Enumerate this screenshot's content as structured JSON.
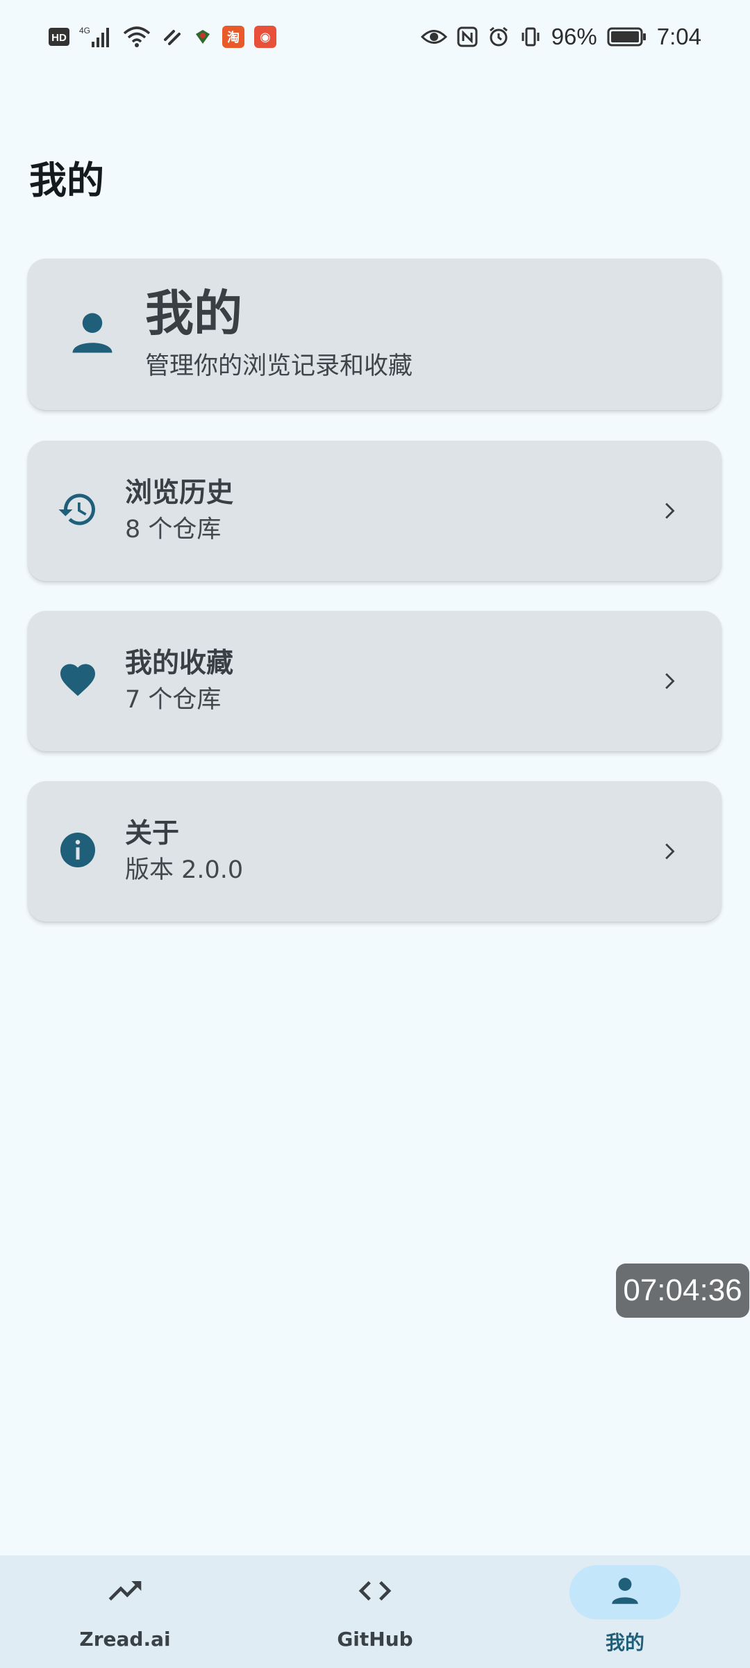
{
  "status_bar": {
    "left_icons": [
      "hd-icon",
      "4g-signal-icon",
      "wifi-icon",
      "link-icon",
      "app-icon-1",
      "taobao-icon",
      "app-icon-2"
    ],
    "battery_percent": "96%",
    "time": "7:04"
  },
  "page": {
    "title": "我的"
  },
  "profile": {
    "title": "我的",
    "subtitle": "管理你的浏览记录和收藏"
  },
  "rows": [
    {
      "title": "浏览历史",
      "subtitle": "8 个仓库",
      "icon": "history-icon"
    },
    {
      "title": "我的收藏",
      "subtitle": "7 个仓库",
      "icon": "heart-icon"
    },
    {
      "title": "关于",
      "subtitle": "版本 2.0.0",
      "icon": "info-icon"
    }
  ],
  "timer": "07:04:36",
  "nav": [
    {
      "label": "Zread.ai",
      "icon": "trending-icon"
    },
    {
      "label": "GitHub",
      "icon": "code-icon"
    },
    {
      "label": "我的",
      "icon": "person-icon",
      "active": true
    }
  ],
  "colors": {
    "accent": "#1f5f7a",
    "card": "#dee3e8",
    "background": "#f3fafd",
    "nav_active": "#c4e6fb"
  }
}
